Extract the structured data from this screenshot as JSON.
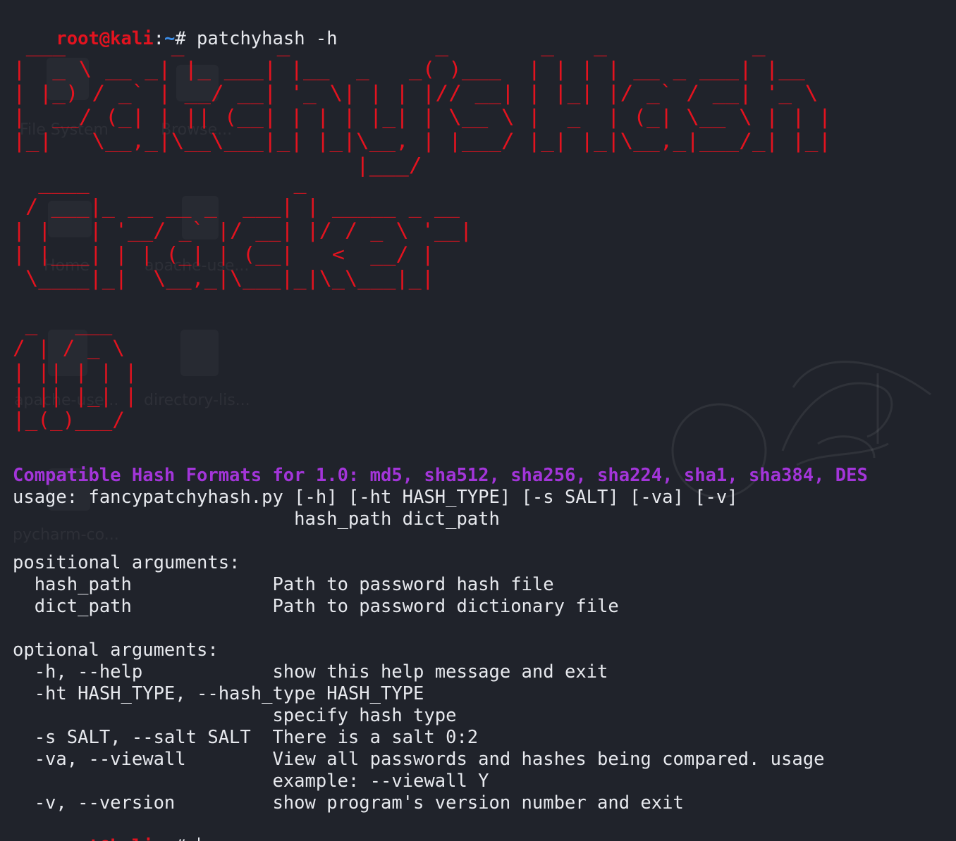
{
  "prompt": {
    "user": "root@kali",
    "sep": ":",
    "path": "~",
    "hash": "# "
  },
  "command": "patchyhash -h",
  "banner": {
    "line1": " ___        _       _           _       _   _           _     \n|  _ \\ __ _| |_ ___| |__  _   _( )___  | | | | __ _ ___| |__  \n| |_) / _` | __/ __| '_ \\| | | |// __| | |_| |/ _` / __| '_ \\ \n|  __/ (_| | || (__| | | | |_| | \\__ \\ |  _  | (_| \\__ \\ | | |\n|_|   \\__,_|\\__\\___|_| |_|\\__, | |___/ |_| |_|\\__,_|___/_| |_|\n                          |___/                               ",
    "line2": "  ____                _             \n / ___|_ __ __ _  ___| | _____ _ __ \n| |   | '__/ _` |/ __| |/ / _ \\ '__|\n| |___| | | (_| | (__|   <  __/ |   \n \\____|_|  \\__,_|\\___|_|\\_\\___|_|   ",
    "line3": " _   ___  \n/ | / _ \\ \n| || | | |\n| || |_| |\n|_(_)___/ "
  },
  "formats_line": "Compatible Hash Formats for 1.0: md5, sha512, sha256, sha224, sha1, sha384, DES",
  "help": {
    "usage_1": "usage: fancypatchyhash.py [-h] [-ht HASH_TYPE] [-s SALT] [-va] [-v]",
    "usage_2": "                          hash_path dict_path",
    "positional_header": "positional arguments:",
    "positional": [
      "  hash_path             Path to password hash file",
      "  dict_path             Path to password dictionary file"
    ],
    "optional_header": "optional arguments:",
    "optional": [
      "  -h, --help            show this help message and exit",
      "  -ht HASH_TYPE, --hash_type HASH_TYPE",
      "                        specify hash type",
      "  -s SALT, --salt SALT  There is a salt 0:2",
      "  -va, --viewall        View all passwords and hashes being compared. usage",
      "                        example: --viewall Y",
      "  -v, --version         show program's version number and exit"
    ]
  },
  "colors": {
    "background": "#20232b",
    "prompt_user": "#e3131f",
    "prompt_path": "#3b8eea",
    "banner": "#e3131f",
    "formats": "#a335d9",
    "text": "#e7e9ee"
  },
  "desktop_icons": [
    {
      "label": "File System",
      "icon": "file-system-icon"
    },
    {
      "label": "Browse...",
      "icon": "browse-icon"
    },
    {
      "label": "Home",
      "icon": "home-folder-icon"
    },
    {
      "label": "apache-use...",
      "icon": "folder-icon"
    },
    {
      "label": "apache-use...",
      "icon": "file-icon"
    },
    {
      "label": "directory-lis...",
      "icon": "document-icon"
    },
    {
      "label": "pycharm-co...",
      "icon": "app-icon"
    }
  ]
}
